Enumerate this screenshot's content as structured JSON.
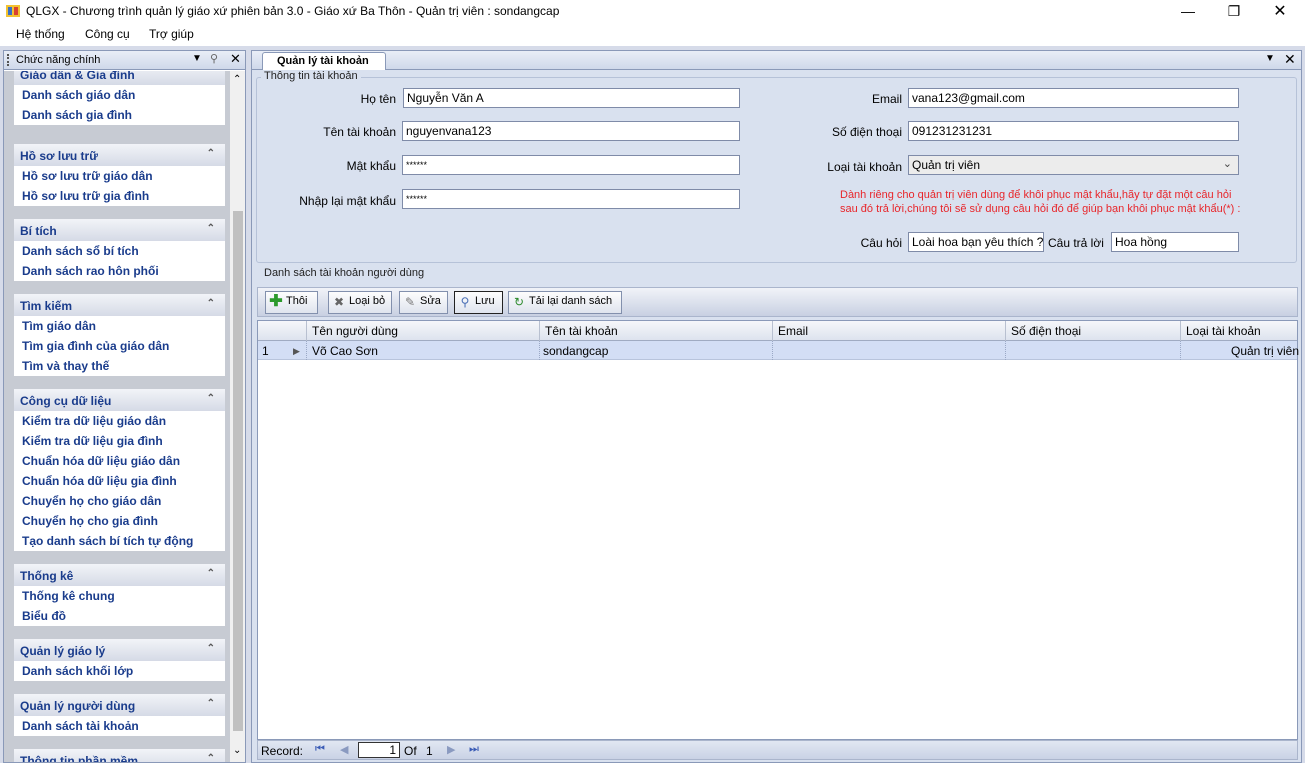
{
  "window": {
    "title": "QLGX - Chương trình quản lý giáo xứ phiên bản 3.0 - Giáo xứ Ba Thôn - Quản trị viên : sondangcap",
    "icon": "app-logo-icon"
  },
  "menu": [
    "Hệ thống",
    "Công cụ",
    "Trợ giúp"
  ],
  "sidebar": {
    "title": "Chức năng chính",
    "groups": [
      {
        "title": "Giáo dân & Gia đình",
        "items": [
          "Danh sách giáo dân",
          "Danh sách gia đình"
        ]
      },
      {
        "title": "Hồ sơ lưu trữ",
        "items": [
          "Hồ sơ lưu trữ giáo dân",
          "Hồ sơ lưu trữ gia đình"
        ]
      },
      {
        "title": "Bí tích",
        "items": [
          "Danh sách sổ bí tích",
          "Danh sách rao hôn phối"
        ]
      },
      {
        "title": "Tìm kiếm",
        "items": [
          "Tìm giáo dân",
          "Tìm gia đình của giáo dân",
          "Tìm và thay thế"
        ]
      },
      {
        "title": "Công cụ dữ liệu",
        "items": [
          "Kiểm tra dữ liệu giáo dân",
          "Kiểm tra dữ liệu gia đình",
          "Chuẩn hóa dữ liệu giáo dân",
          "Chuẩn hóa dữ liệu gia đình",
          "Chuyển họ cho giáo dân",
          "Chuyển họ cho gia đình",
          "Tạo danh sách bí tích tự động"
        ]
      },
      {
        "title": "Thống kê",
        "items": [
          "Thống kê chung",
          "Biểu đồ"
        ]
      },
      {
        "title": "Quản lý giáo lý",
        "items": [
          "Danh sách khối lớp"
        ]
      },
      {
        "title": "Quản lý người dùng",
        "items": [
          "Danh sách tài khoản"
        ]
      },
      {
        "title": "Thông tin phần mềm",
        "items": []
      }
    ]
  },
  "tab": {
    "label": "Quản lý tài khoản"
  },
  "account_form": {
    "group_title": "Thông tin tài khoản",
    "fullname_label": "Họ tên",
    "fullname_value": "Nguyễn Văn A",
    "username_label": "Tên tài khoản",
    "username_value": "nguyenvana123",
    "password_label": "Mật khẩu",
    "password_value": "******",
    "confirm_label": "Nhập lại mật khẩu",
    "confirm_value": "******",
    "email_label": "Email",
    "email_value": "vana123@gmail.com",
    "phone_label": "Số điện thoại",
    "phone_value": "091231231231",
    "type_label": "Loại tài khoản",
    "type_value": "Quản trị viên",
    "note_line1": "Dành riêng cho quản trị viên dùng để khôi phục mật khẩu,hãy tự đặt một câu hỏi",
    "note_line2": "sau đó trả lời,chúng tôi sẽ sử dụng câu hỏi đó để giúp bạn khôi phục mật khẩu(*) :",
    "question_label": "Câu hỏi",
    "question_value": "Loài hoa bạn yêu thích ?",
    "answer_label": "Câu trả lời",
    "answer_value": "Hoa hồng"
  },
  "user_list": {
    "group_title": "Danh sách tài khoản người dùng",
    "toolbar": {
      "add": "Thôi",
      "remove": "Loại bỏ",
      "edit": "Sửa",
      "save": "Lưu",
      "reload": "Tải lại danh sách"
    },
    "columns": [
      "Tên người dùng",
      "Tên tài khoản",
      "Email",
      "Số điện thoại",
      "Loại tài khoản"
    ],
    "rows": [
      {
        "index": "1",
        "name": "Võ Cao Sơn",
        "username": "sondangcap",
        "email": "",
        "phone": "",
        "type": "Quản trị viên"
      }
    ],
    "navigator": {
      "label": "Record:",
      "position": "1",
      "of_label": "Of",
      "total": "1"
    }
  },
  "colors": {
    "accent_text": "#1a3c8c",
    "note_red": "#e8262b",
    "panel_bg": "#d9e1ef",
    "selected_row": "#d3def5"
  }
}
